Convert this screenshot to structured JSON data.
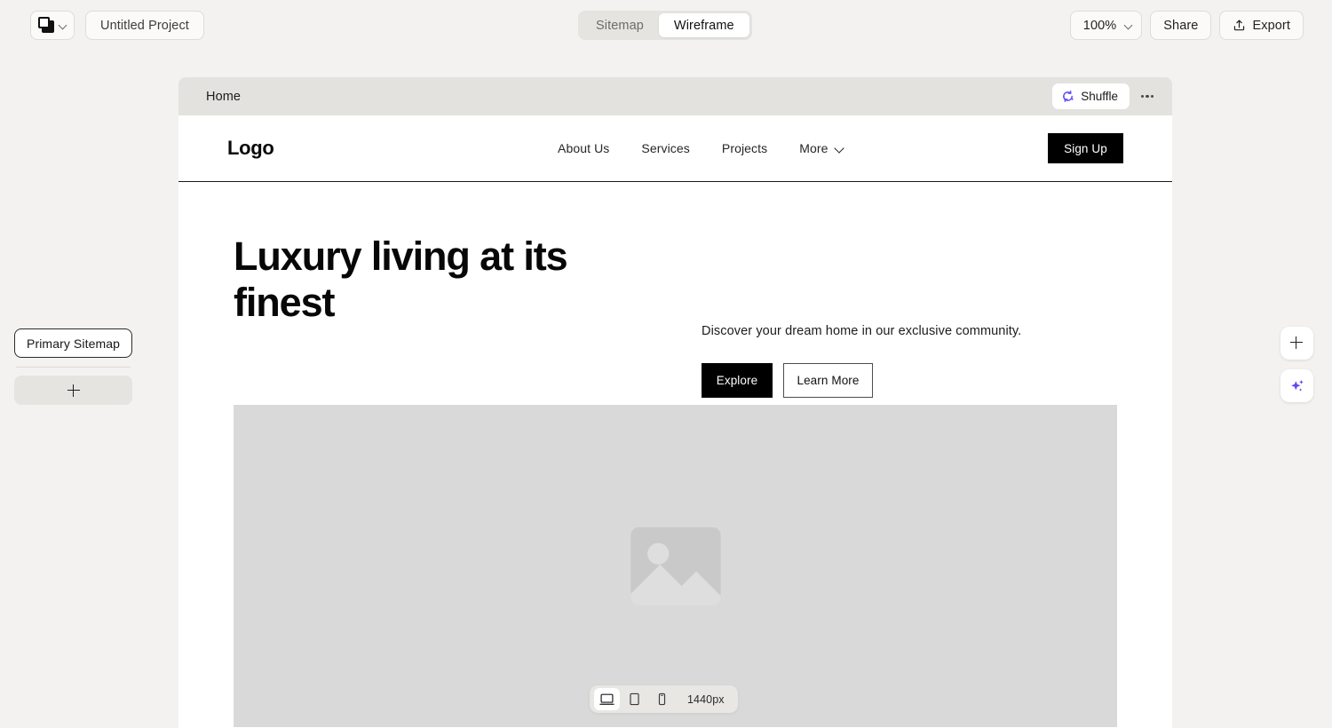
{
  "topbar": {
    "logo_icon": "app-logo-squares-icon",
    "logo_dropdown_icon": "chevron-down-icon",
    "project_name": "Untitled Project",
    "project_name_placeholder": "Untitled Project",
    "tabs": [
      {
        "label": "Sitemap",
        "active": false
      },
      {
        "label": "Wireframe",
        "active": true
      }
    ],
    "zoom_level": "100%",
    "zoom_dropdown_icon": "chevron-down-icon",
    "share_label": "Share",
    "export_label": "Export",
    "export_icon": "upload-icon"
  },
  "sidebar": {
    "sitemap_chip": "Primary Sitemap",
    "add_icon": "plus-icon"
  },
  "frame": {
    "title": "Home",
    "shuffle_label": "Shuffle",
    "shuffle_icon": "refresh-sparkle-icon",
    "more_icon": "ellipsis-icon"
  },
  "wireframe": {
    "logo_text": "Logo",
    "nav_links": [
      {
        "label": "About Us",
        "has_chevron": false
      },
      {
        "label": "Services",
        "has_chevron": false
      },
      {
        "label": "Projects",
        "has_chevron": false
      },
      {
        "label": "More",
        "has_chevron": true
      }
    ],
    "signup_label": "Sign Up",
    "hero": {
      "headline": "Luxury living at its finest",
      "subtext": "Discover your dream home in our exclusive community.",
      "primary_cta": "Explore",
      "secondary_cta": "Learn More"
    },
    "image_placeholder_icon": "image-placeholder-icon"
  },
  "device_bar": {
    "devices": [
      {
        "name": "desktop-icon",
        "active": true
      },
      {
        "name": "tablet-icon",
        "active": false
      },
      {
        "name": "mobile-icon",
        "active": false
      }
    ],
    "width_label": "1440px"
  },
  "float_actions": {
    "add_icon": "plus-icon",
    "ai_icon": "sparkles-icon"
  },
  "colors": {
    "canvas_bg": "#f3f2f0",
    "frame_header_bg": "#e4e2df",
    "accent_purple": "#5b4bf5",
    "placeholder_gray": "#d9d9d9",
    "black": "#000000"
  }
}
